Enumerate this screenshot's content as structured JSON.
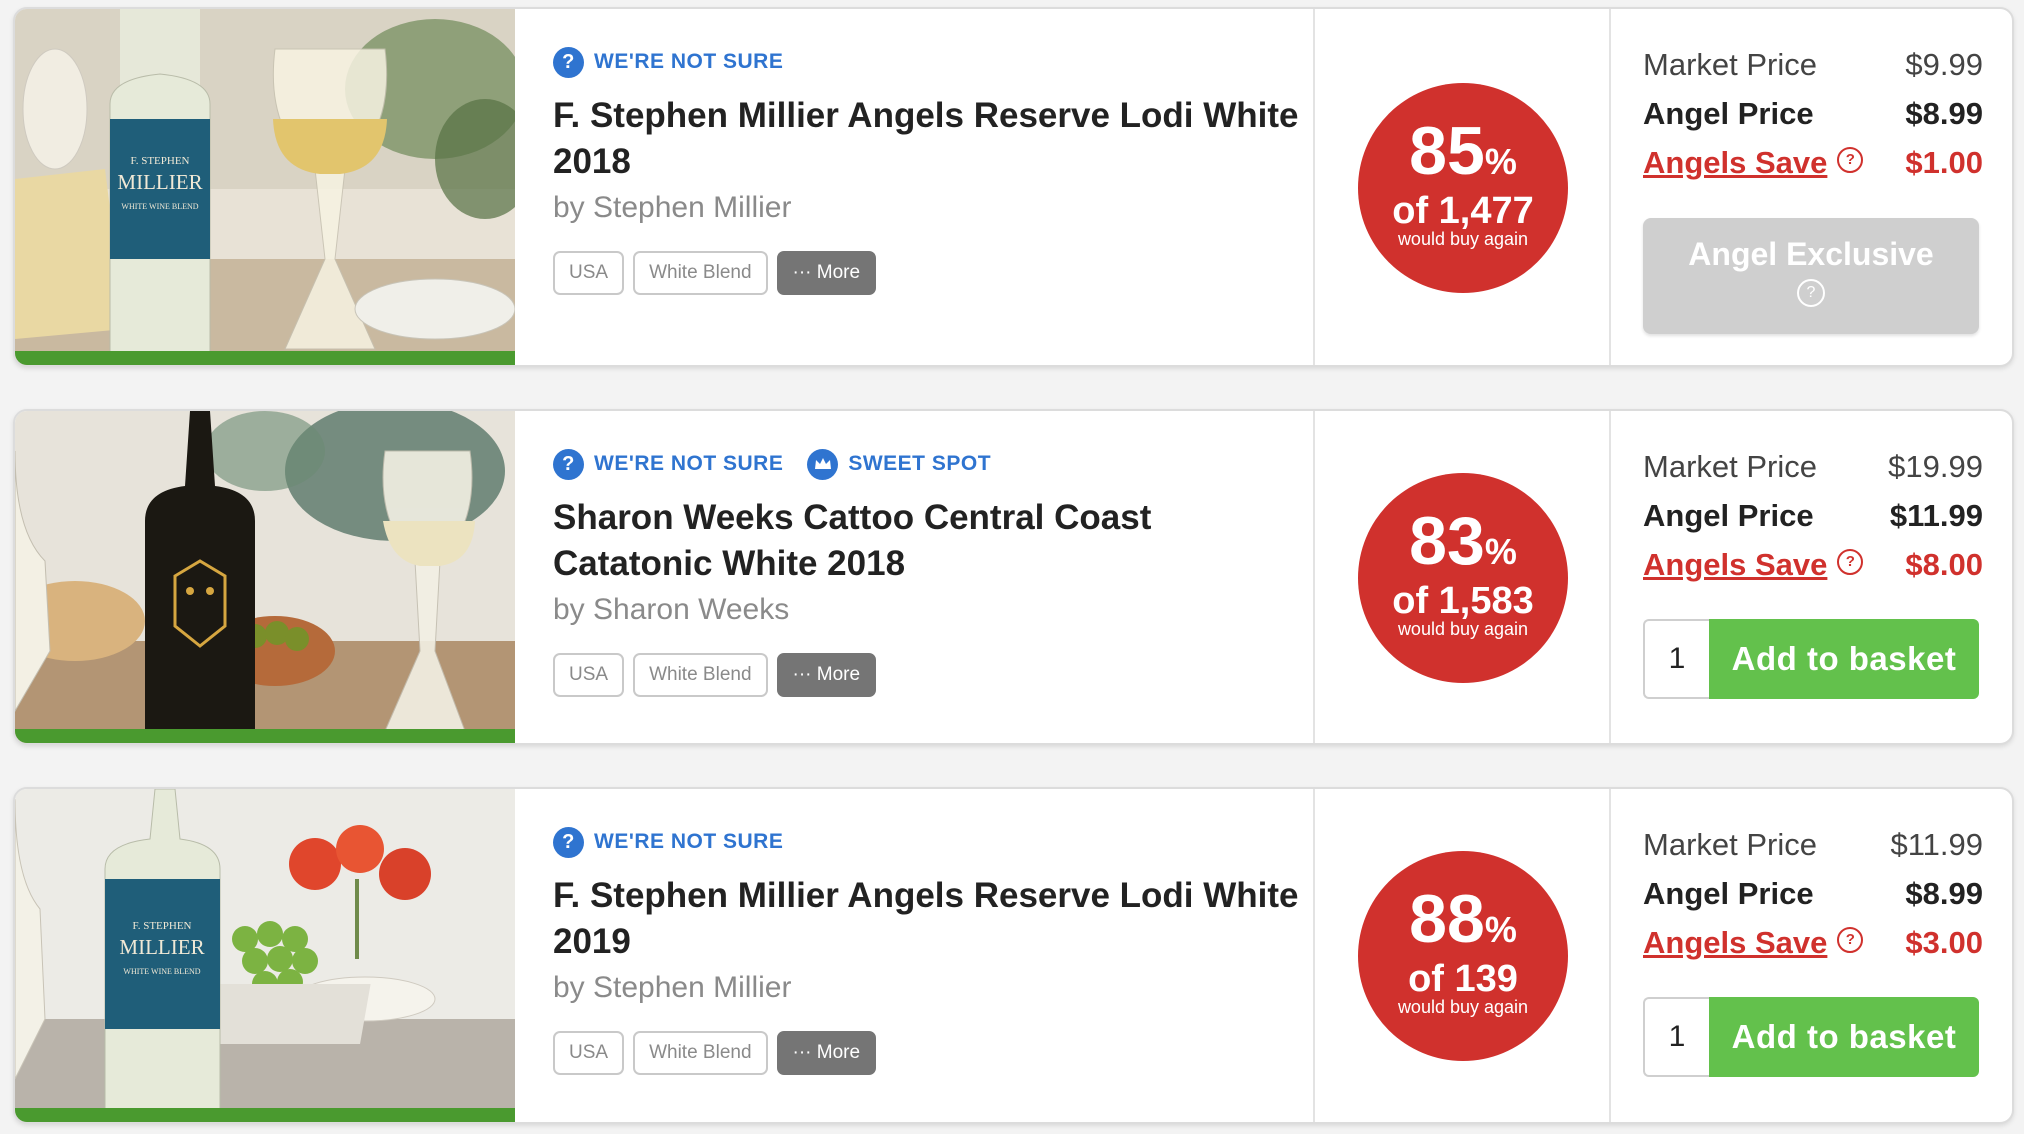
{
  "labels": {
    "market_price": "Market Price",
    "angel_price": "Angel Price",
    "angels_save": "Angels Save",
    "would_buy_again": "would buy again",
    "more": "··· More",
    "question_mark": "?",
    "percent_sign": "%",
    "add_to_basket": "Add to basket",
    "angel_exclusive": "Angel Exclusive"
  },
  "colors": {
    "accent_blue": "#2f74d0",
    "badge_red": "#d0312d",
    "add_green": "#63c14c",
    "bar_green": "#4a9a2f"
  },
  "products": [
    {
      "flags": [
        "WE'RE NOT SURE"
      ],
      "name": "F. Stephen Millier Angels Reserve Lodi White 2018",
      "producer": "by Stephen Millier",
      "tags": [
        "USA",
        "White Blend"
      ],
      "rating_pct": "85",
      "rating_count": "of 1,477",
      "market_price": "$9.99",
      "angel_price": "$8.99",
      "save": "$1.00",
      "action": "Angel Exclusive",
      "label_text": [
        "F. STEPHEN",
        "MILLIER",
        "WHITE WINE BLEND"
      ]
    },
    {
      "flags": [
        "WE'RE NOT SURE",
        "SWEET SPOT"
      ],
      "name": "Sharon Weeks Cattoo Central Coast Catatonic White 2018",
      "producer": "by Sharon Weeks",
      "tags": [
        "USA",
        "White Blend"
      ],
      "rating_pct": "83",
      "rating_count": "of 1,583",
      "market_price": "$19.99",
      "angel_price": "$11.99",
      "save": "$8.00",
      "quantity": "1"
    },
    {
      "flags": [
        "WE'RE NOT SURE"
      ],
      "name": "F. Stephen Millier Angels Reserve Lodi White 2019",
      "producer": "by Stephen Millier",
      "tags": [
        "USA",
        "White Blend"
      ],
      "rating_pct": "88",
      "rating_count": "of 139",
      "market_price": "$11.99",
      "angel_price": "$8.99",
      "save": "$3.00",
      "quantity": "1",
      "label_text": [
        "F. STEPHEN",
        "MILLIER",
        "WHITE WINE BLEND"
      ]
    }
  ]
}
